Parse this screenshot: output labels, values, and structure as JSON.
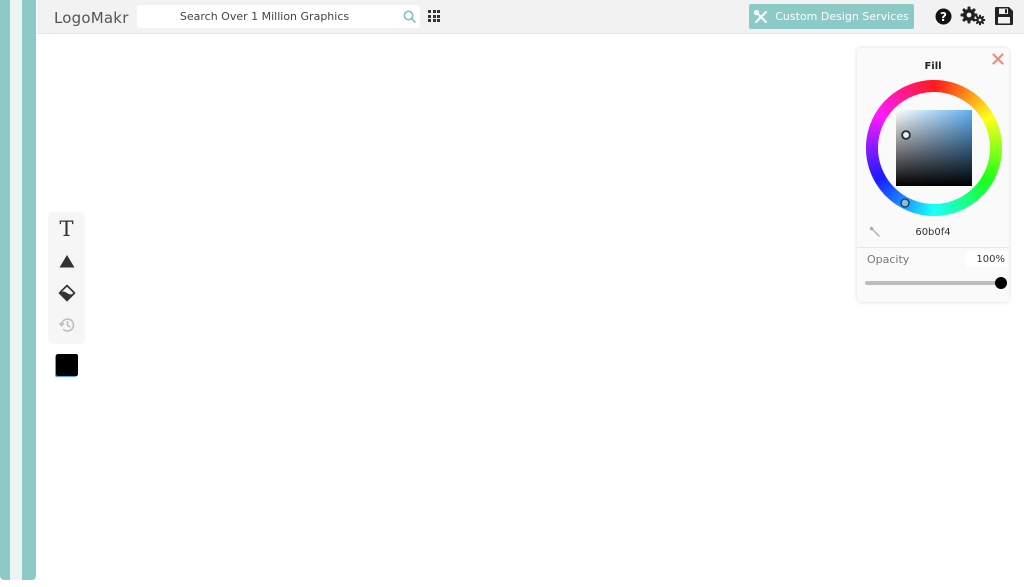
{
  "app": {
    "logo": "LogoMakr"
  },
  "header": {
    "search": {
      "placeholder": "Search Over 1 Million Graphics",
      "value": ""
    },
    "custom_design_label": "Custom Design Services",
    "icons": [
      "search-icon",
      "grid-icon",
      "tools-icon",
      "help-icon",
      "gear-icon",
      "save-icon"
    ]
  },
  "toolbar": {
    "text_tool_label": "T",
    "icons": [
      "text-tool-icon",
      "shape-tool-icon",
      "fill-tool-icon",
      "history-icon"
    ]
  },
  "current_color": {
    "hex": "#000000"
  },
  "color_panel": {
    "title": "Fill",
    "hex_value": "60b0f4",
    "opacity_label": "Opacity",
    "opacity_value": "100%",
    "opacity_level": 1.0
  },
  "colors": {
    "accent": "#8ccac8",
    "close": "#f08c7a",
    "selected_color": "#60b0f4"
  }
}
